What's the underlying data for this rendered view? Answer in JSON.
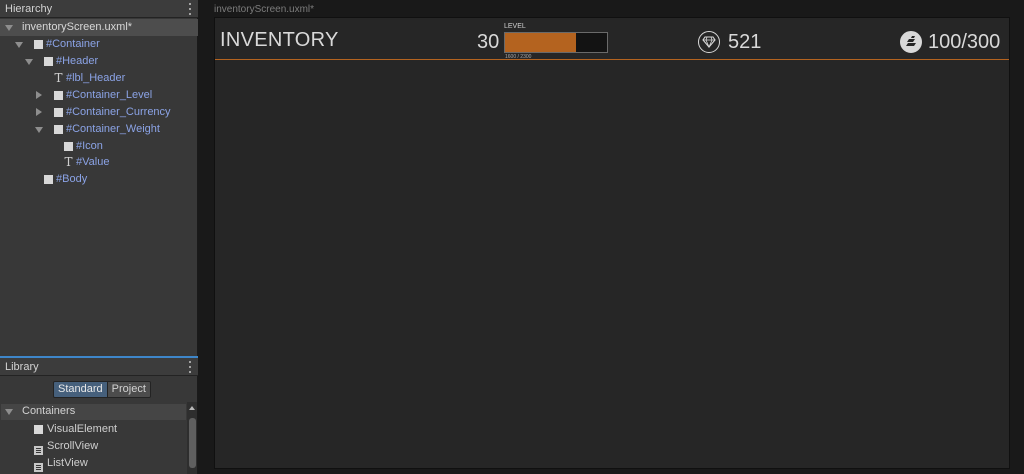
{
  "hierarchy": {
    "title": "Hierarchy",
    "file": "inventoryScreen.uxml*",
    "items": [
      {
        "label": "#Container",
        "icon": "element-icon",
        "expanded": true
      },
      {
        "label": "#Header",
        "icon": "element-icon",
        "expanded": true
      },
      {
        "label": "#lbl_Header",
        "icon": "label-icon"
      },
      {
        "label": "#Container_Level",
        "icon": "element-icon",
        "expanded": false
      },
      {
        "label": "#Container_Currency",
        "icon": "element-icon",
        "expanded": false
      },
      {
        "label": "#Container_Weight",
        "icon": "element-icon",
        "expanded": true
      },
      {
        "label": "#Icon",
        "icon": "element-icon"
      },
      {
        "label": "#Value",
        "icon": "label-icon"
      },
      {
        "label": "#Body",
        "icon": "element-icon"
      }
    ]
  },
  "library": {
    "title": "Library",
    "tabs": [
      "Standard",
      "Project"
    ],
    "active_tab": "Standard",
    "category": "Containers",
    "items": [
      {
        "label": "VisualElement",
        "icon": "element-icon"
      },
      {
        "label": "ScrollView",
        "icon": "list-icon"
      },
      {
        "label": "ListView",
        "icon": "list-icon"
      }
    ]
  },
  "canvas": {
    "title": "inventoryScreen.uxml*",
    "header": {
      "title": "INVENTORY",
      "level": {
        "value": "30",
        "caption": "LEVEL",
        "progress_text": "1600 / 2300",
        "progress_fraction": 0.7
      },
      "currency": {
        "icon": "gem-icon",
        "value": "521"
      },
      "weight": {
        "icon": "weight-icon",
        "value": "100/300"
      }
    }
  },
  "colors": {
    "accent": "#b4631f",
    "tree_label": "#8ba3e6",
    "selection": "#3e86c9"
  }
}
